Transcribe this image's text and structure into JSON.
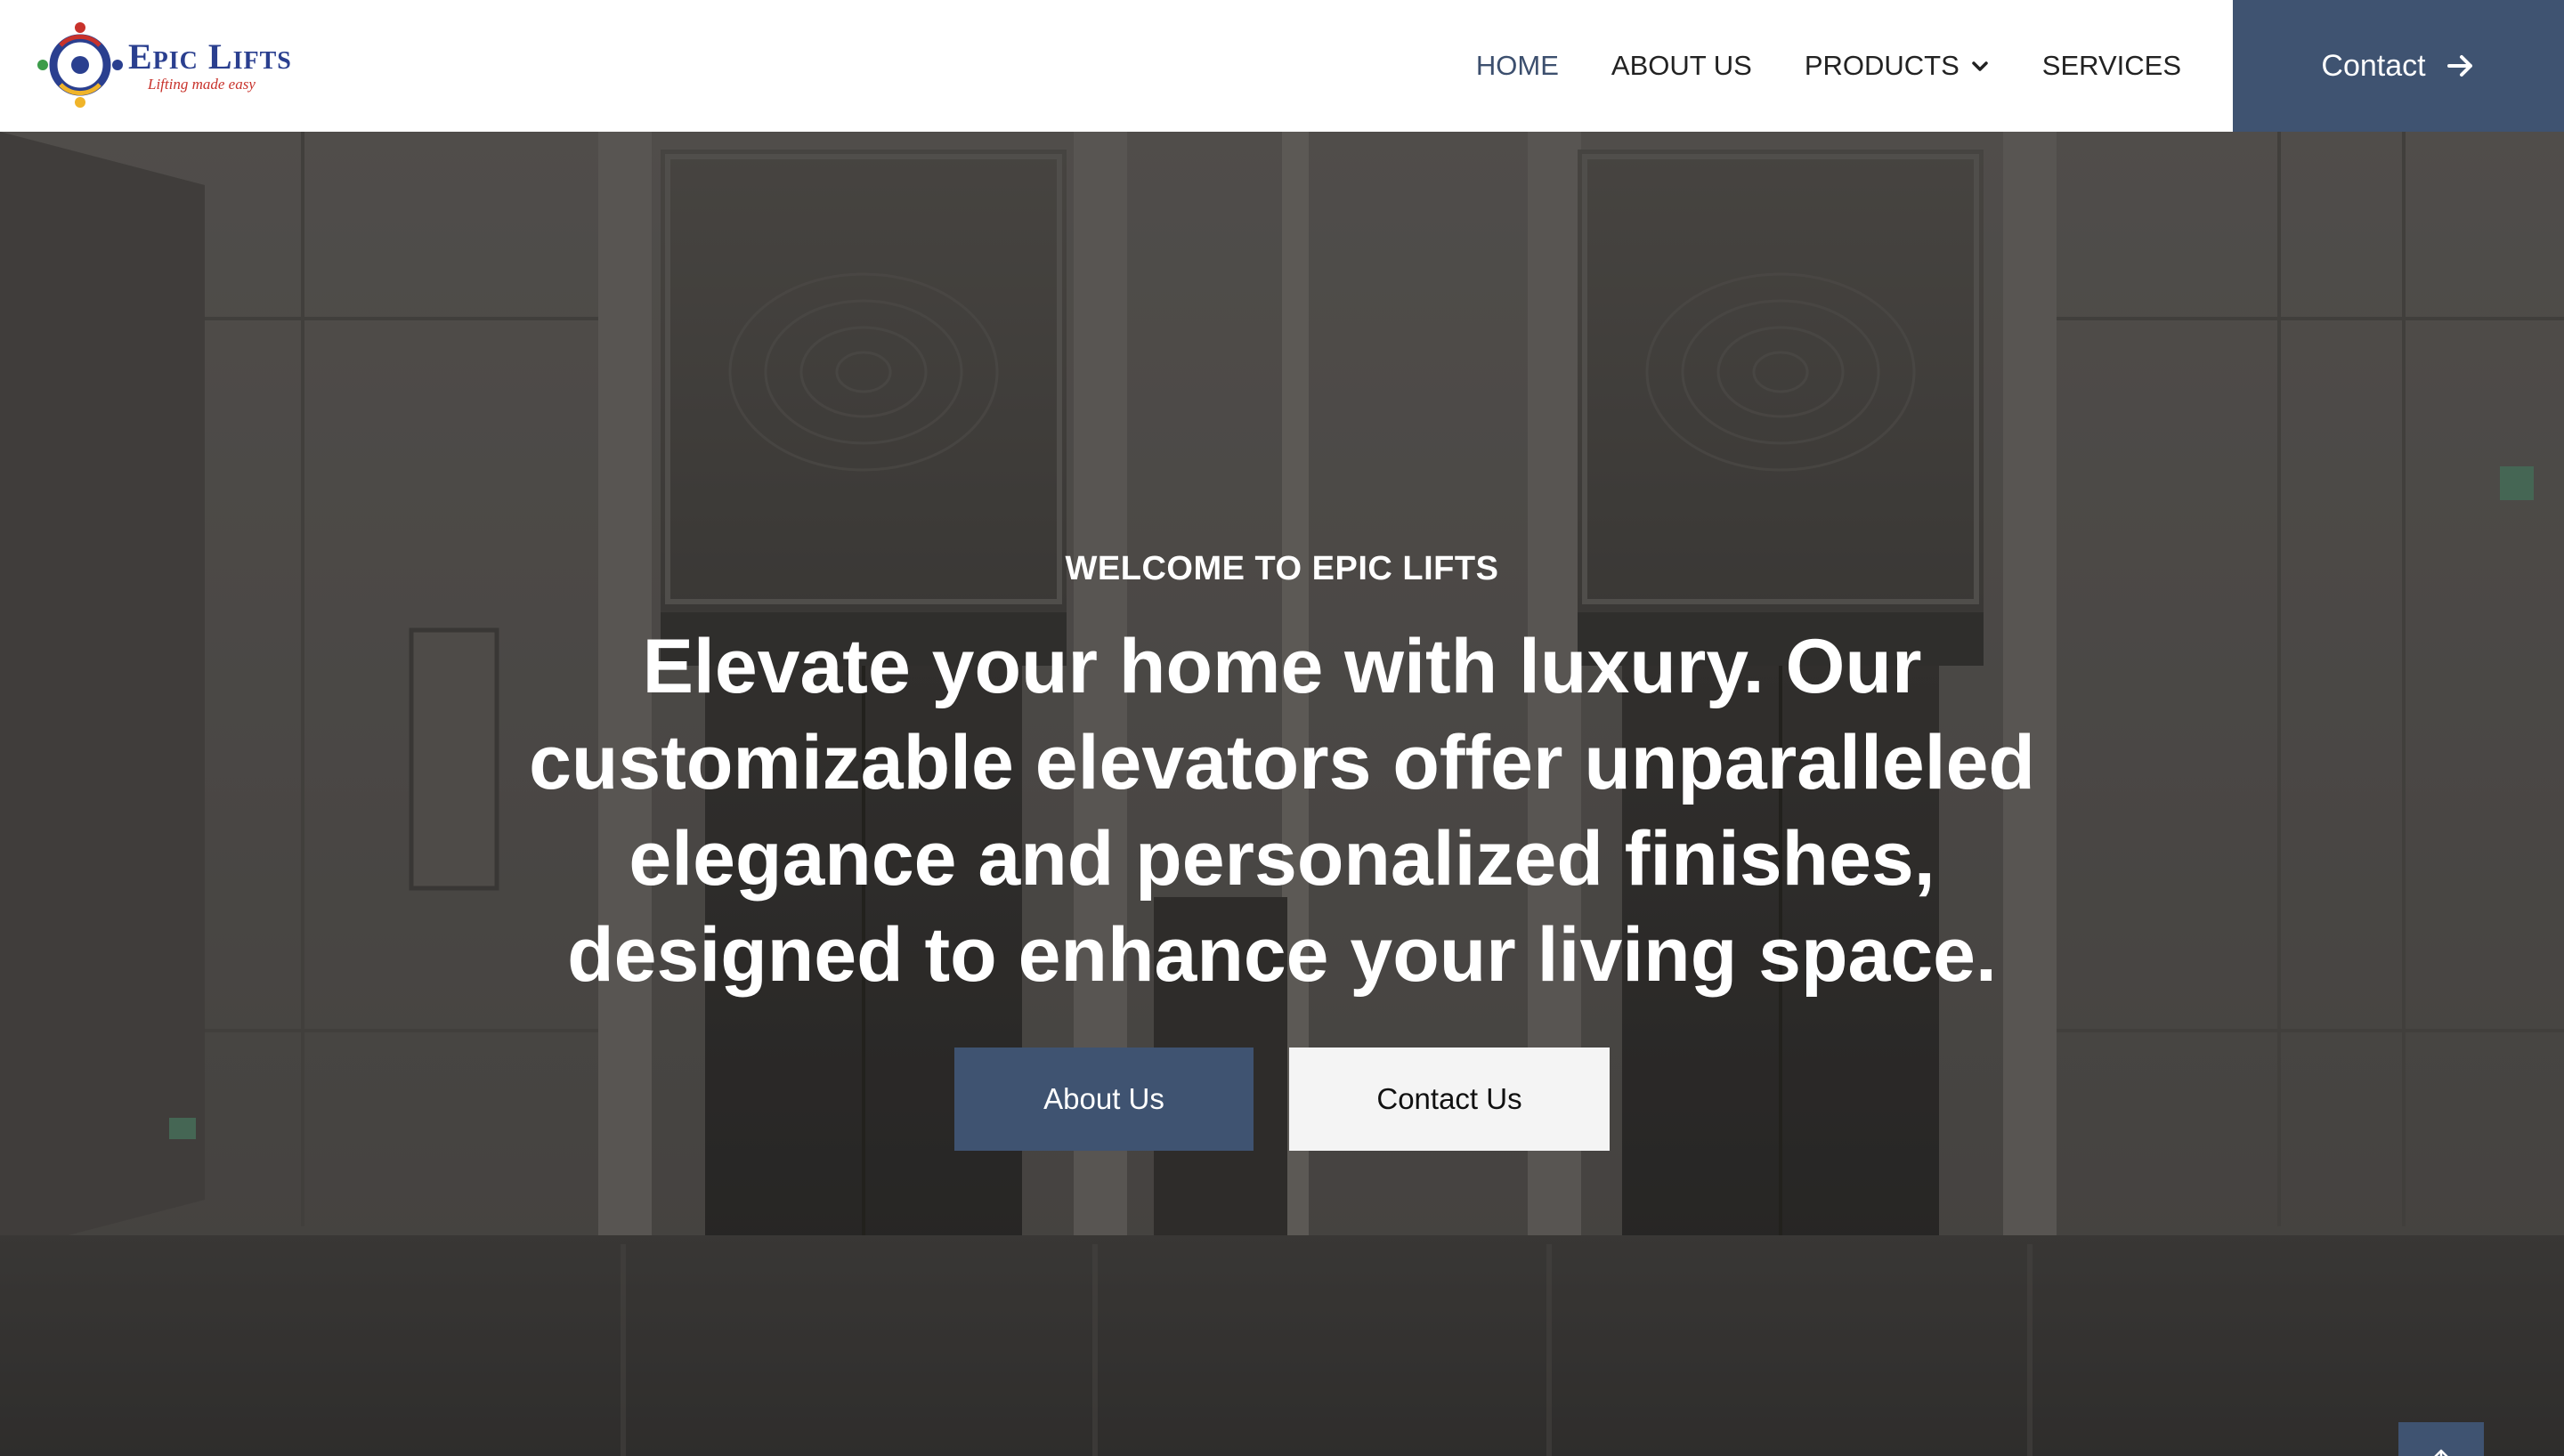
{
  "brand": {
    "name": "Epic Lifts",
    "tagline": "Lifting made easy",
    "colors": {
      "primary": "#3f5371",
      "logo_blue": "#2a3f8f",
      "logo_red": "#c8322b",
      "logo_yellow": "#f0b429",
      "logo_green": "#3c9c4a"
    }
  },
  "nav": {
    "items": [
      {
        "label": "HOME",
        "active": true
      },
      {
        "label": "ABOUT US",
        "active": false
      },
      {
        "label": "PRODUCTS",
        "active": false,
        "has_dropdown": true
      },
      {
        "label": "SERVICES",
        "active": false
      }
    ],
    "cta_label": "Contact",
    "cta_icon": "arrow-right-icon"
  },
  "hero": {
    "eyebrow": "WELCOME TO EPIC LIFTS",
    "headline": "Elevate your home with luxury. Our customizable elevators offer unparalleled elegance and personalized finishes, designed to enhance your living space.",
    "primary_button": "About Us",
    "secondary_button": "Contact Us",
    "background": "elevator-lobby-photo"
  },
  "scroll_top_icon": "arrow-up-icon"
}
